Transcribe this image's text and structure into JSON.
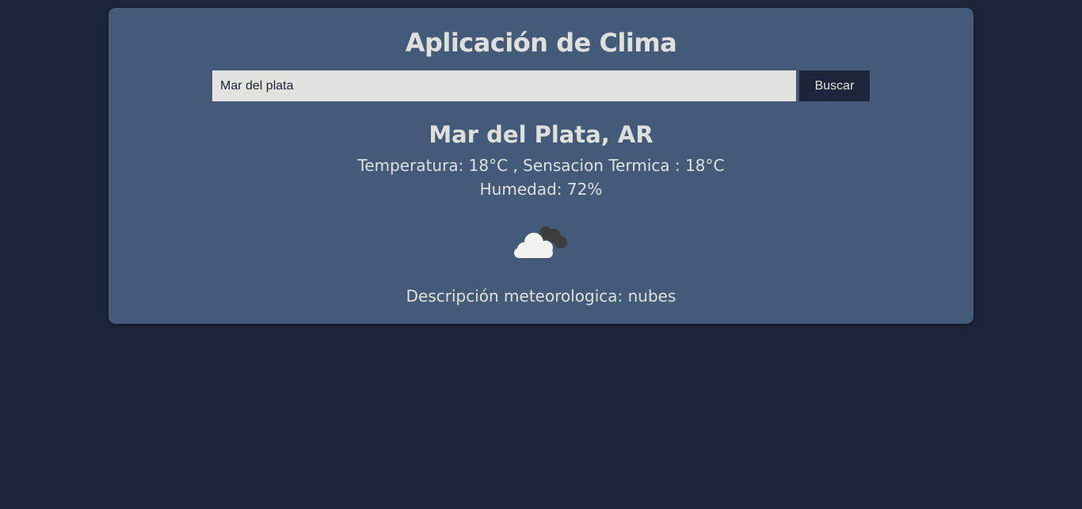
{
  "app": {
    "title": "Aplicación de Clima"
  },
  "search": {
    "value": "Mar del plata",
    "button_label": "Buscar"
  },
  "weather": {
    "location": "Mar del Plata, AR",
    "temperature_text": "Temperatura: 18°C , Sensacion Termica : 18°C",
    "humidity_text": "Humedad: 72%",
    "icon": "cloudy-icon",
    "description_text": "Descripción meteorologica: nubes"
  },
  "colors": {
    "background": "#1c2539",
    "card": "#435b79",
    "text": "#dfe0dc",
    "input_background": "#e2e2de",
    "button_background": "#1c2539"
  }
}
